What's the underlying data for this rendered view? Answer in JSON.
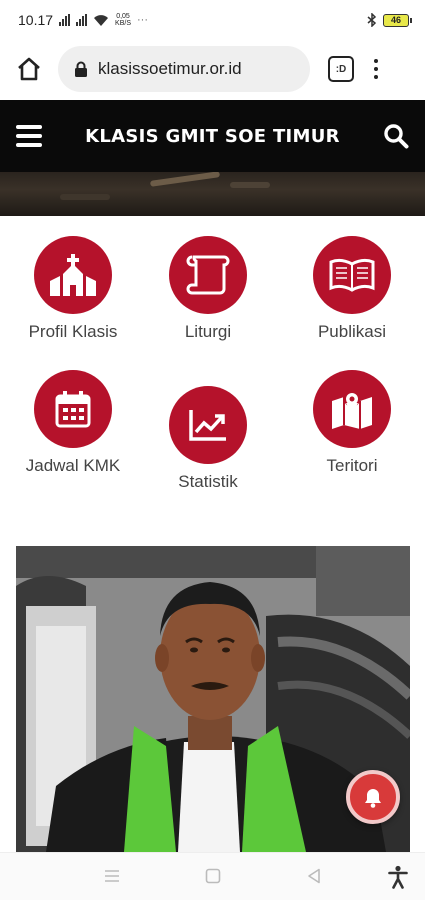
{
  "status_bar": {
    "time": "10.17",
    "net_speed_top": "0,05",
    "net_speed_bottom": "KB/S",
    "more_dots": "···",
    "battery": "46"
  },
  "browser": {
    "url": "klasissoetimur.or.id",
    "tab_count": ":D"
  },
  "header": {
    "title": "KLASIS GMIT SOE TIMUR"
  },
  "menu": [
    {
      "label": "Profil Klasis",
      "icon": "church-icon"
    },
    {
      "label": "Liturgi",
      "icon": "scroll-icon"
    },
    {
      "label": "Publikasi",
      "icon": "book-icon"
    },
    {
      "label": "Jadwal KMK",
      "icon": "calendar-icon"
    },
    {
      "label": "Statistik",
      "icon": "chart-line-icon"
    },
    {
      "label": "Teritori",
      "icon": "map-icon"
    }
  ],
  "colors": {
    "accent": "#b5122b",
    "header_bg": "#0a0a0a",
    "bell": "#d83a3a"
  }
}
